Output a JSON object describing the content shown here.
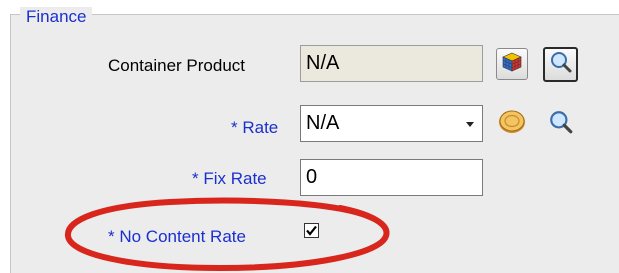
{
  "panel": {
    "title": "Finance"
  },
  "rows": {
    "container_product": {
      "label": "Container Product",
      "value": "N/A"
    },
    "rate": {
      "label": "* Rate",
      "value": "N/A"
    },
    "fix_rate": {
      "label": "* Fix Rate",
      "value": "0"
    },
    "no_content_rate": {
      "label": "* No Content Rate",
      "checked": true
    }
  },
  "icons": {
    "cube": "rubiks-cube-icon",
    "magnifier": "magnifier-icon",
    "coin": "coin-icon"
  },
  "colors": {
    "required_label": "#1a2fd0",
    "highlight_ellipse": "#d9261c",
    "readonly_field": "#ebe9dd"
  }
}
